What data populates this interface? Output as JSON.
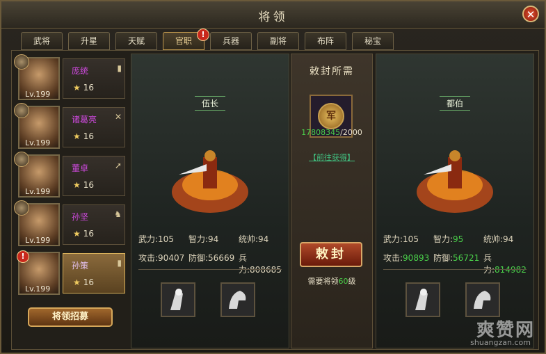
{
  "window": {
    "title": "将领",
    "close_symbol": "✕"
  },
  "tabs": [
    {
      "label": "武将"
    },
    {
      "label": "升星"
    },
    {
      "label": "天赋"
    },
    {
      "label": "官职",
      "active": true,
      "badge": "!"
    },
    {
      "label": "兵器"
    },
    {
      "label": "副将"
    },
    {
      "label": "布阵"
    },
    {
      "label": "秘宝"
    }
  ],
  "generals": [
    {
      "name": "庞统",
      "level": "Lv.199",
      "stars": "16",
      "type_icon": "shield-icon"
    },
    {
      "name": "诸葛亮",
      "level": "Lv.199",
      "stars": "16",
      "type_icon": "crossbow-icon"
    },
    {
      "name": "董卓",
      "level": "Lv.199",
      "stars": "16",
      "type_icon": "spear-icon"
    },
    {
      "name": "孙坚",
      "level": "Lv.199",
      "stars": "16",
      "type_icon": "horse-icon"
    },
    {
      "name": "孙策",
      "level": "Lv.199",
      "stars": "16",
      "type_icon": "shield-icon",
      "selected": true,
      "alert": "!"
    }
  ],
  "recruit_label": "将领招募",
  "left_stage": {
    "rank": "伍长",
    "stats": {
      "wuli_label": "武力:",
      "wuli": "105",
      "zhili_label": "智力:",
      "zhili": "94",
      "tongshuai_label": "统帅:",
      "tongshuai": "94",
      "gongji_label": "攻击:",
      "gongji": "90407",
      "fangyu_label": "防御:",
      "fangyu": "56669",
      "bingli_label": "兵力:",
      "bingli": "808685"
    }
  },
  "right_stage": {
    "rank": "都伯",
    "stats": {
      "wuli_label": "武力:",
      "wuli": "105",
      "zhili_label": "智力:",
      "zhili": "95",
      "tongshuai_label": "统帅:",
      "tongshuai": "94",
      "gongji_label": "攻击:",
      "gongji": "90893",
      "fangyu_label": "防御:",
      "fangyu": "56721",
      "bingli_label": "兵力:",
      "bingli": "814982"
    }
  },
  "center": {
    "title": "敕封所需",
    "coin_char": "军",
    "owned": "17808345",
    "required": "/2000",
    "goto_label": "【前往获得】",
    "promote_label": "敕封",
    "req_prefix": "需要将领",
    "req_level": "60",
    "req_suffix": "级"
  },
  "watermark": {
    "main": "爽赞网",
    "sub": "shuangzan.com"
  },
  "colors": {
    "green": "#4ad04a",
    "name_purple": "#d04ae0",
    "accent_gold": "#d8b05a"
  }
}
